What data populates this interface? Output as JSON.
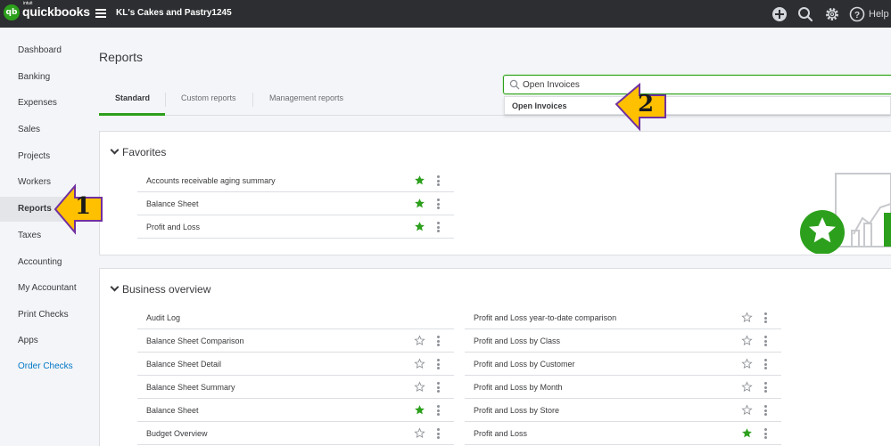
{
  "app": {
    "logo_intuit": "intuit",
    "logo_name": "quickbooks",
    "logo_badge": "qb",
    "company_name": "KL's Cakes and Pastry1245",
    "help_label": "Help",
    "icons": [
      "plus-icon",
      "search-icon",
      "gear-icon",
      "help-icon"
    ]
  },
  "sidebar": {
    "items": [
      {
        "label": "Dashboard"
      },
      {
        "label": "Banking"
      },
      {
        "label": "Expenses"
      },
      {
        "label": "Sales"
      },
      {
        "label": "Projects"
      },
      {
        "label": "Workers"
      },
      {
        "label": "Reports",
        "active": true
      },
      {
        "label": "Taxes"
      },
      {
        "label": "Accounting"
      },
      {
        "label": "My Accountant"
      },
      {
        "label": "Print Checks"
      },
      {
        "label": "Apps"
      },
      {
        "label": "Order Checks",
        "link": true
      }
    ]
  },
  "main": {
    "title": "Reports",
    "tabs": [
      {
        "label": "Standard",
        "active": true
      },
      {
        "label": "Custom reports"
      },
      {
        "label": "Management reports"
      }
    ],
    "search": {
      "value": "Open Invoices",
      "suggestion": "Open Invoices"
    }
  },
  "favorites": {
    "heading": "Favorites",
    "rows": [
      {
        "label": "Accounts receivable aging summary",
        "favorite": true
      },
      {
        "label": "Balance Sheet",
        "favorite": true
      },
      {
        "label": "Profit and Loss",
        "favorite": true
      }
    ]
  },
  "business_overview": {
    "heading": "Business overview",
    "left": [
      {
        "label": "Audit Log",
        "favorite": null
      },
      {
        "label": "Balance Sheet Comparison",
        "favorite": false
      },
      {
        "label": "Balance Sheet Detail",
        "favorite": false
      },
      {
        "label": "Balance Sheet Summary",
        "favorite": false
      },
      {
        "label": "Balance Sheet",
        "favorite": true
      },
      {
        "label": "Budget Overview",
        "favorite": false
      }
    ],
    "right": [
      {
        "label": "Profit and Loss year-to-date comparison",
        "favorite": false
      },
      {
        "label": "Profit and Loss by Class",
        "favorite": false
      },
      {
        "label": "Profit and Loss by Customer",
        "favorite": false
      },
      {
        "label": "Profit and Loss by Month",
        "favorite": false
      },
      {
        "label": "Profit and Loss by Store",
        "favorite": false
      },
      {
        "label": "Profit and Loss",
        "favorite": true
      }
    ]
  },
  "callouts": [
    {
      "number": "1"
    },
    {
      "number": "2"
    }
  ],
  "colors": {
    "brand_green": "#2ca01c",
    "topbar": "#2d2e31",
    "callout_fill": "#ffc000",
    "callout_stroke": "#7030a0",
    "link": "#0077c5"
  }
}
